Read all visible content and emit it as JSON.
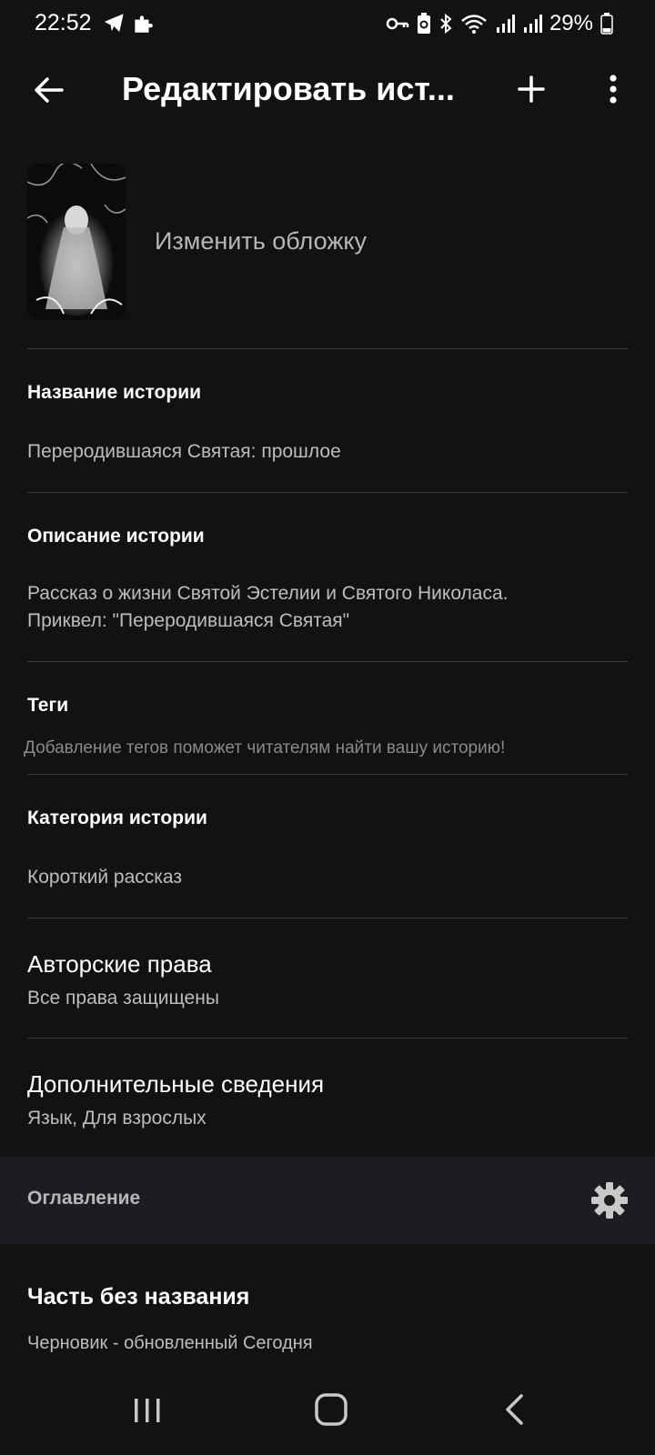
{
  "status_bar": {
    "time": "22:52",
    "battery": "29%",
    "left_icons": [
      "telegram-icon",
      "puzzle-icon"
    ],
    "right_icons": [
      "key-icon",
      "battery-saver-icon",
      "bluetooth-icon",
      "wifi-icon",
      "signal-icon",
      "signal-icon",
      "battery-icon"
    ]
  },
  "app_bar": {
    "title": "Редактировать ист...",
    "icons": [
      "arrow-left-icon",
      "plus-icon",
      "more-vertical-icon"
    ]
  },
  "cover": {
    "change_label": "Изменить обложку"
  },
  "sections": {
    "story_name": {
      "label": "Название истории",
      "value": "Переродившаяся Святая: прошлое"
    },
    "story_description": {
      "label": "Описание истории",
      "line1": "Рассказ о жизни Святой Эстелии и Святого Николаса.",
      "line2": "Приквел: \"Переродившаяся Святая\""
    },
    "tags": {
      "label": "Теги",
      "hint": "Добавление тегов поможет читателям найти вашу историю!"
    },
    "category": {
      "label": "Категория истории",
      "value": "Короткий рассказ"
    },
    "copyright": {
      "label": "Авторские права",
      "value": "Все права защищены"
    },
    "additional": {
      "label": "Дополнительные сведения",
      "value": "Язык, Для взрослых"
    }
  },
  "toc": {
    "label": "Оглавление",
    "icon": "gear-icon"
  },
  "part": {
    "title": "Часть без названия",
    "status": "Черновик - обновленный Сегодня"
  },
  "nav_bar": {
    "icons": [
      "recents-icon",
      "home-icon",
      "back-icon"
    ]
  },
  "colors": {
    "background": "#121114",
    "surface": "#1d1c20",
    "divider": "#3a393d",
    "text_primary": "#ffffff",
    "text_secondary": "#bdbdbf",
    "text_hint": "#8a898d"
  }
}
